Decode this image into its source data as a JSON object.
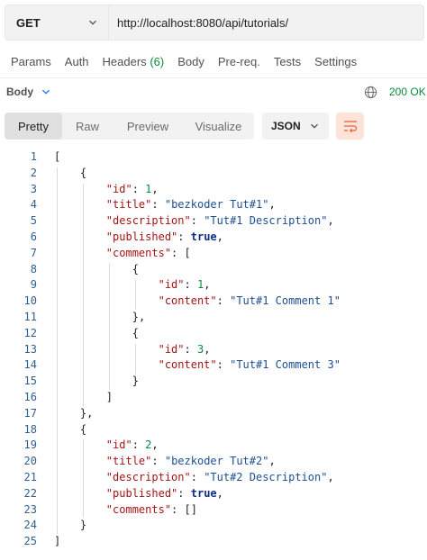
{
  "request": {
    "method": "GET",
    "url": "http://localhost:8080/api/tutorials/"
  },
  "tabs": [
    {
      "label": "Params"
    },
    {
      "label": "Auth"
    },
    {
      "label": "Headers",
      "count": "(6)"
    },
    {
      "label": "Body"
    },
    {
      "label": "Pre-req."
    },
    {
      "label": "Tests"
    },
    {
      "label": "Settings"
    }
  ],
  "response": {
    "body_label": "Body",
    "status": "200 OK",
    "views": [
      "Pretty",
      "Raw",
      "Preview",
      "Visualize"
    ],
    "active_view": "Pretty",
    "format": "JSON"
  },
  "code_lines": [
    "[",
    "    {",
    "        \"id\": 1,",
    "        \"title\": \"bezkoder Tut#1\",",
    "        \"description\": \"Tut#1 Description\",",
    "        \"published\": true,",
    "        \"comments\": [",
    "            {",
    "                \"id\": 1,",
    "                \"content\": \"Tut#1 Comment 1\"",
    "            },",
    "            {",
    "                \"id\": 3,",
    "                \"content\": \"Tut#1 Comment 3\"",
    "            }",
    "        ]",
    "    },",
    "    {",
    "        \"id\": 2,",
    "        \"title\": \"bezkoder Tut#2\",",
    "        \"description\": \"Tut#2 Description\",",
    "        \"published\": true,",
    "        \"comments\": []",
    "    }",
    "]"
  ],
  "colors": {
    "key": "#a31515",
    "string": "#1d4f91",
    "number": "#0a8a3e",
    "boolean": "#0d2e8a",
    "status_ok": "#0a8a3e",
    "wrap_button_bg": "#fde3d8",
    "wrap_icon": "#e8643b"
  },
  "icons": {
    "method_dropdown": "chevron-down-icon",
    "body_dropdown": "chevron-down-icon",
    "network": "globe-icon",
    "format_dropdown": "chevron-down-icon",
    "wrap": "wrap-lines-icon"
  }
}
